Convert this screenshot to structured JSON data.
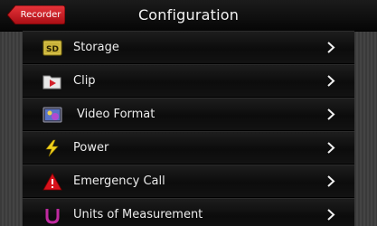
{
  "header": {
    "title": "Configuration",
    "back_label": "Recorder"
  },
  "menu": {
    "items": [
      {
        "label": "Storage",
        "icon": "sd-card-icon"
      },
      {
        "label": "Clip",
        "icon": "folder-video-icon"
      },
      {
        "label": "Video Format",
        "icon": "video-format-icon"
      },
      {
        "label": "Power",
        "icon": "lightning-bolt-icon"
      },
      {
        "label": "Emergency Call",
        "icon": "warning-icon"
      },
      {
        "label": "Units of Measurement",
        "icon": "units-u-icon"
      }
    ]
  },
  "colors": {
    "back_button": "#c8121a",
    "background": "#3c3c3c",
    "row": "#111111",
    "text": "#ececec"
  }
}
